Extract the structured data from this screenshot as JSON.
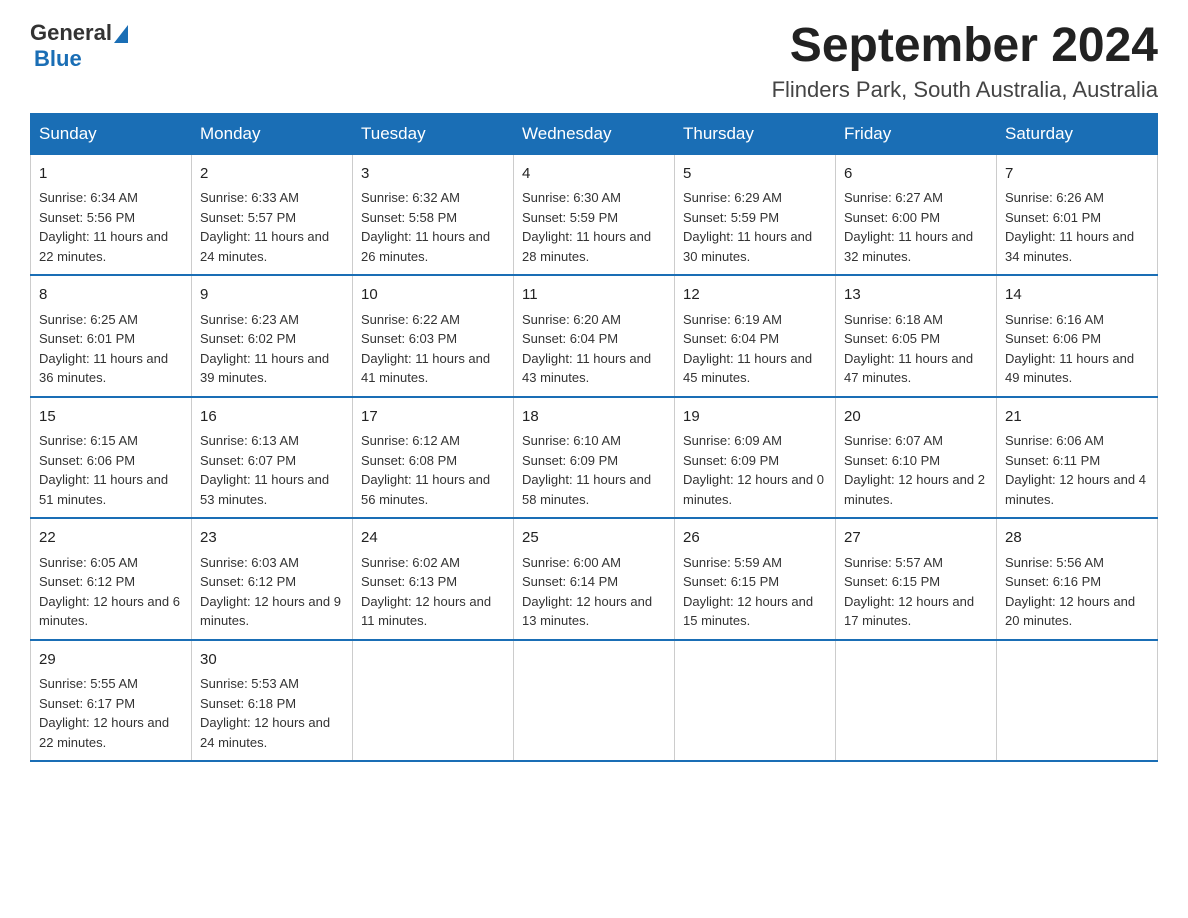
{
  "header": {
    "logo_general": "General",
    "logo_blue": "Blue",
    "title": "September 2024",
    "subtitle": "Flinders Park, South Australia, Australia"
  },
  "calendar": {
    "days_of_week": [
      "Sunday",
      "Monday",
      "Tuesday",
      "Wednesday",
      "Thursday",
      "Friday",
      "Saturday"
    ],
    "weeks": [
      [
        {
          "day": "1",
          "sunrise": "6:34 AM",
          "sunset": "5:56 PM",
          "daylight": "11 hours and 22 minutes."
        },
        {
          "day": "2",
          "sunrise": "6:33 AM",
          "sunset": "5:57 PM",
          "daylight": "11 hours and 24 minutes."
        },
        {
          "day": "3",
          "sunrise": "6:32 AM",
          "sunset": "5:58 PM",
          "daylight": "11 hours and 26 minutes."
        },
        {
          "day": "4",
          "sunrise": "6:30 AM",
          "sunset": "5:59 PM",
          "daylight": "11 hours and 28 minutes."
        },
        {
          "day": "5",
          "sunrise": "6:29 AM",
          "sunset": "5:59 PM",
          "daylight": "11 hours and 30 minutes."
        },
        {
          "day": "6",
          "sunrise": "6:27 AM",
          "sunset": "6:00 PM",
          "daylight": "11 hours and 32 minutes."
        },
        {
          "day": "7",
          "sunrise": "6:26 AM",
          "sunset": "6:01 PM",
          "daylight": "11 hours and 34 minutes."
        }
      ],
      [
        {
          "day": "8",
          "sunrise": "6:25 AM",
          "sunset": "6:01 PM",
          "daylight": "11 hours and 36 minutes."
        },
        {
          "day": "9",
          "sunrise": "6:23 AM",
          "sunset": "6:02 PM",
          "daylight": "11 hours and 39 minutes."
        },
        {
          "day": "10",
          "sunrise": "6:22 AM",
          "sunset": "6:03 PM",
          "daylight": "11 hours and 41 minutes."
        },
        {
          "day": "11",
          "sunrise": "6:20 AM",
          "sunset": "6:04 PM",
          "daylight": "11 hours and 43 minutes."
        },
        {
          "day": "12",
          "sunrise": "6:19 AM",
          "sunset": "6:04 PM",
          "daylight": "11 hours and 45 minutes."
        },
        {
          "day": "13",
          "sunrise": "6:18 AM",
          "sunset": "6:05 PM",
          "daylight": "11 hours and 47 minutes."
        },
        {
          "day": "14",
          "sunrise": "6:16 AM",
          "sunset": "6:06 PM",
          "daylight": "11 hours and 49 minutes."
        }
      ],
      [
        {
          "day": "15",
          "sunrise": "6:15 AM",
          "sunset": "6:06 PM",
          "daylight": "11 hours and 51 minutes."
        },
        {
          "day": "16",
          "sunrise": "6:13 AM",
          "sunset": "6:07 PM",
          "daylight": "11 hours and 53 minutes."
        },
        {
          "day": "17",
          "sunrise": "6:12 AM",
          "sunset": "6:08 PM",
          "daylight": "11 hours and 56 minutes."
        },
        {
          "day": "18",
          "sunrise": "6:10 AM",
          "sunset": "6:09 PM",
          "daylight": "11 hours and 58 minutes."
        },
        {
          "day": "19",
          "sunrise": "6:09 AM",
          "sunset": "6:09 PM",
          "daylight": "12 hours and 0 minutes."
        },
        {
          "day": "20",
          "sunrise": "6:07 AM",
          "sunset": "6:10 PM",
          "daylight": "12 hours and 2 minutes."
        },
        {
          "day": "21",
          "sunrise": "6:06 AM",
          "sunset": "6:11 PM",
          "daylight": "12 hours and 4 minutes."
        }
      ],
      [
        {
          "day": "22",
          "sunrise": "6:05 AM",
          "sunset": "6:12 PM",
          "daylight": "12 hours and 6 minutes."
        },
        {
          "day": "23",
          "sunrise": "6:03 AM",
          "sunset": "6:12 PM",
          "daylight": "12 hours and 9 minutes."
        },
        {
          "day": "24",
          "sunrise": "6:02 AM",
          "sunset": "6:13 PM",
          "daylight": "12 hours and 11 minutes."
        },
        {
          "day": "25",
          "sunrise": "6:00 AM",
          "sunset": "6:14 PM",
          "daylight": "12 hours and 13 minutes."
        },
        {
          "day": "26",
          "sunrise": "5:59 AM",
          "sunset": "6:15 PM",
          "daylight": "12 hours and 15 minutes."
        },
        {
          "day": "27",
          "sunrise": "5:57 AM",
          "sunset": "6:15 PM",
          "daylight": "12 hours and 17 minutes."
        },
        {
          "day": "28",
          "sunrise": "5:56 AM",
          "sunset": "6:16 PM",
          "daylight": "12 hours and 20 minutes."
        }
      ],
      [
        {
          "day": "29",
          "sunrise": "5:55 AM",
          "sunset": "6:17 PM",
          "daylight": "12 hours and 22 minutes."
        },
        {
          "day": "30",
          "sunrise": "5:53 AM",
          "sunset": "6:18 PM",
          "daylight": "12 hours and 24 minutes."
        },
        null,
        null,
        null,
        null,
        null
      ]
    ],
    "sunrise_label": "Sunrise:",
    "sunset_label": "Sunset:",
    "daylight_label": "Daylight:"
  }
}
